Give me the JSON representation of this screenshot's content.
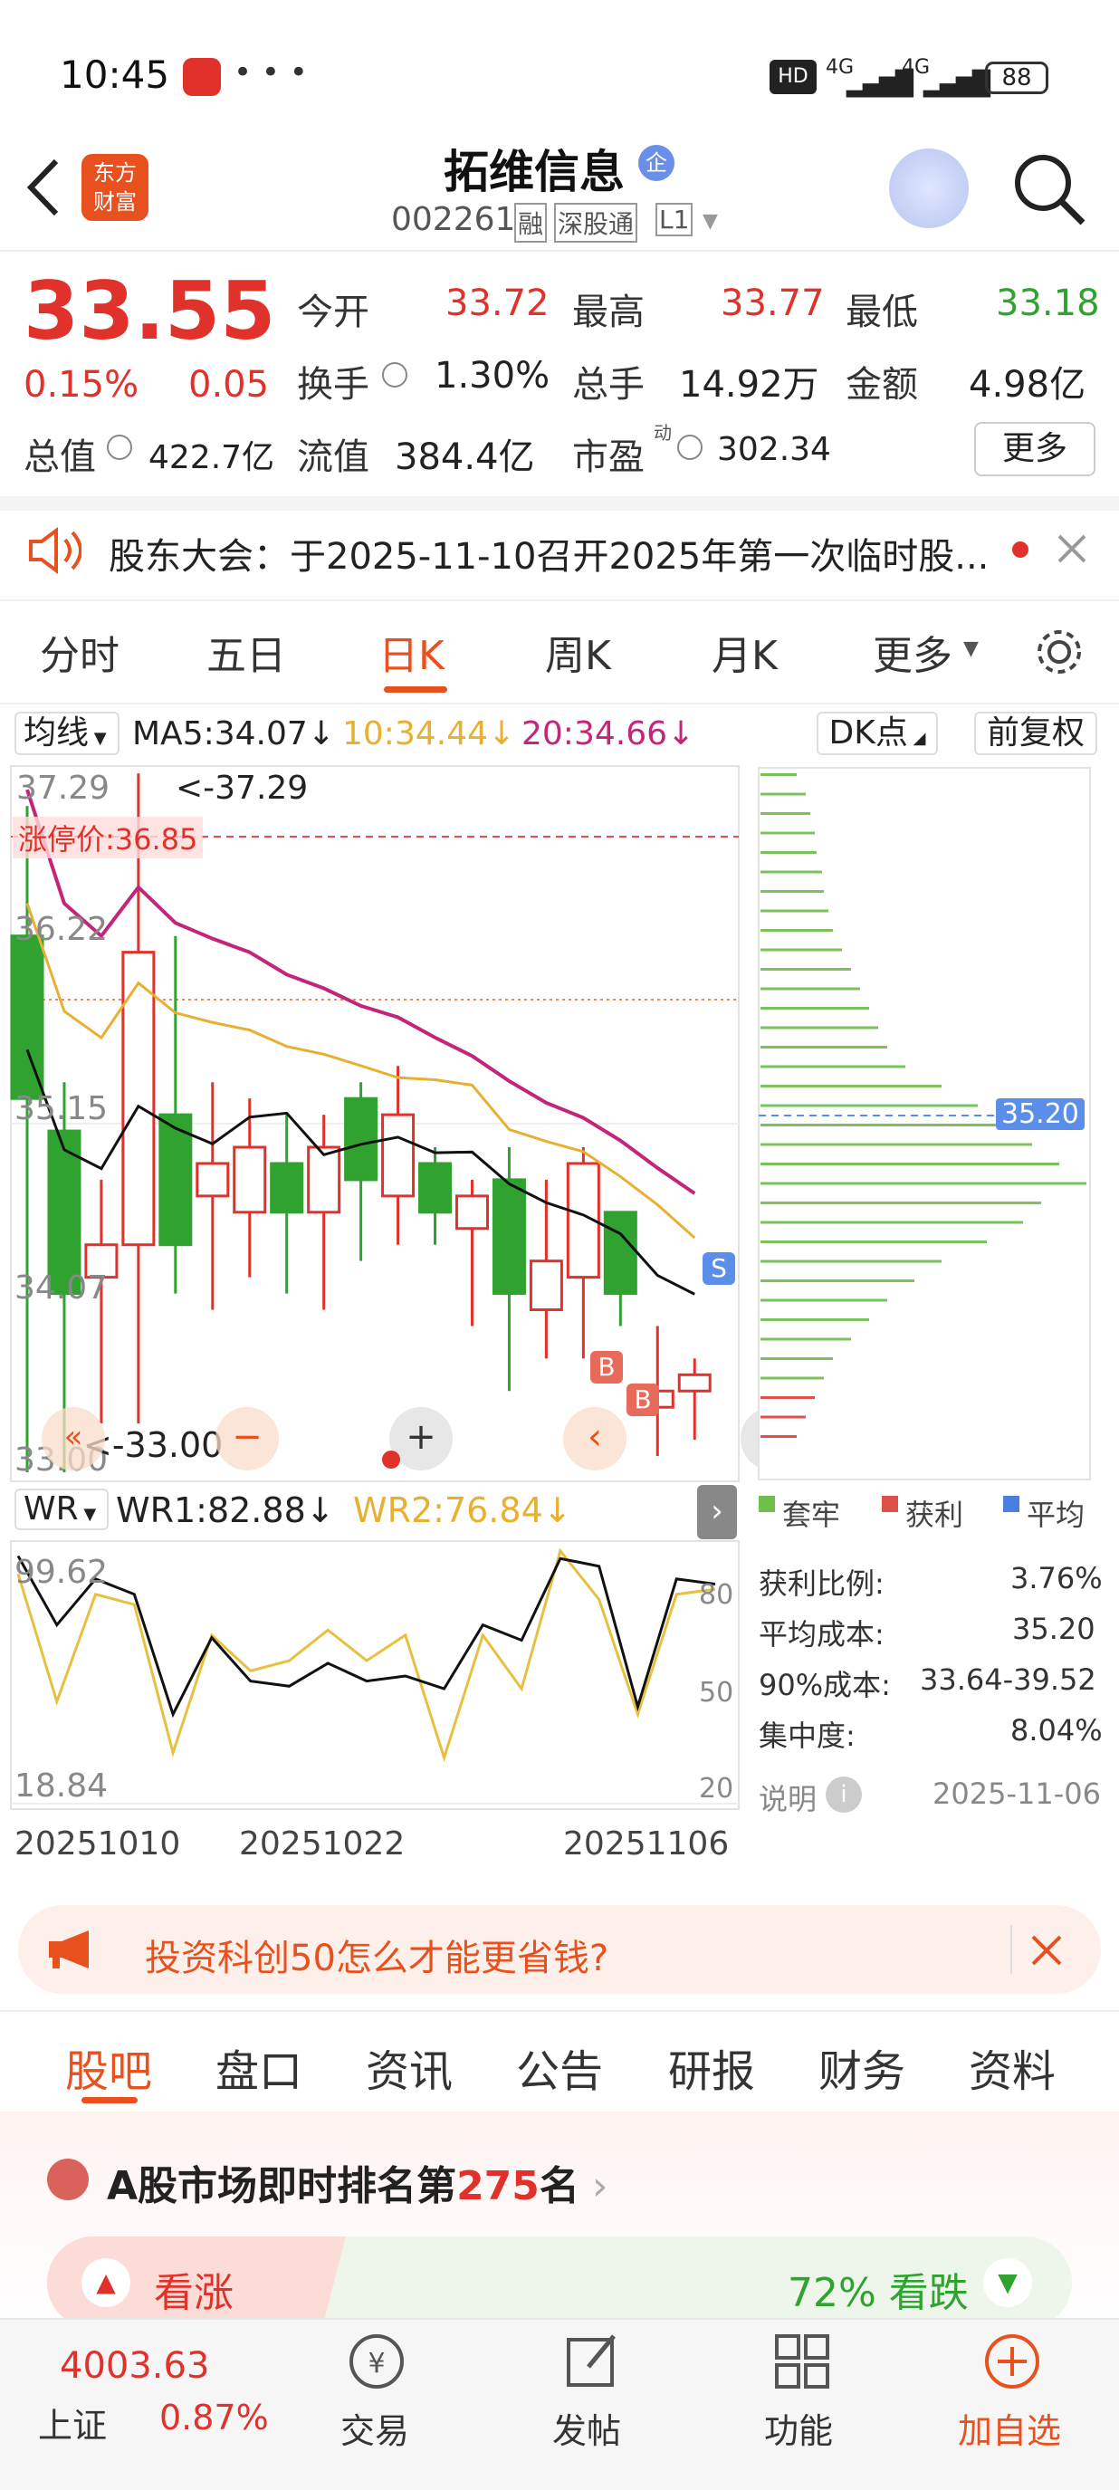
{
  "status": {
    "time": "10:45",
    "battery": "88",
    "net1": "4G",
    "net2": "4G",
    "hd": "HD"
  },
  "header": {
    "logo_line1": "东方",
    "logo_line2": "财富",
    "title": "拓维信息",
    "badge": "企",
    "code": "002261",
    "tags": [
      "融",
      "深股通",
      "L1"
    ]
  },
  "quote": {
    "price": "33.55",
    "pct": "0.15%",
    "chg": "0.05",
    "open_label": "今开",
    "open": "33.72",
    "high_label": "最高",
    "high": "33.77",
    "low_label": "最低",
    "low": "33.18",
    "turn_label": "换手",
    "turn": "1.30%",
    "vol_label": "总手",
    "vol": "14.92万",
    "amt_label": "金额",
    "amt": "4.98亿",
    "mcap_label": "总值",
    "mcap": "422.7亿",
    "fcap_label": "流值",
    "fcap": "384.4亿",
    "pe_label": "市盈",
    "pe_sup": "动",
    "pe": "302.34",
    "more": "更多"
  },
  "notice": {
    "text": "股东大会：于2025-11-10召开2025年第一次临时股..."
  },
  "tabs": [
    "分时",
    "五日",
    "日K",
    "周K",
    "月K",
    "更多"
  ],
  "ma": {
    "selector": "均线",
    "ma5": "MA5:34.07",
    "ma10": "10:34.44",
    "ma20": "20:34.66",
    "dk": "DK点",
    "fq": "前复权"
  },
  "main_chart": {
    "y_top": "37.29",
    "top_note": "<-37.29",
    "limit": "涨停价:36.85",
    "y2": "36.22",
    "y3": "35.15",
    "y4": "34.07",
    "y_bottom": "33.00",
    "bottom_note": "<-33.00",
    "cost_tag": "35.20"
  },
  "wr": {
    "selector": "WR",
    "wr1": "WR1:82.88",
    "wr2": "WR2:76.84",
    "y_top": "99.62",
    "y_bottom": "18.84",
    "r80": "80",
    "r50": "50",
    "r20": "20",
    "dates": [
      "20251010",
      "20251022",
      "20251106"
    ]
  },
  "chips": {
    "legend": [
      "套牢",
      "获利",
      "平均"
    ],
    "rows": [
      [
        "获利比例:",
        "3.76%"
      ],
      [
        "平均成本:",
        "35.20"
      ],
      [
        "90%成本:",
        "33.64-39.52"
      ],
      [
        "集中度:",
        "8.04%"
      ]
    ],
    "note": "说明",
    "date": "2025-11-06"
  },
  "ad": {
    "text": "投资科创50怎么才能更省钱?"
  },
  "nav": [
    "股吧",
    "盘口",
    "资讯",
    "公告",
    "研报",
    "财务",
    "资料"
  ],
  "rank": {
    "pre": "A股市场即时排名第",
    "num": "275",
    "post": "名"
  },
  "vote": {
    "up": "看涨",
    "down": "72% 看跌"
  },
  "bottom": {
    "index": "4003.63",
    "index_name": "上证",
    "index_pct": "0.87%",
    "items": [
      "交易",
      "发帖",
      "功能",
      "加自选"
    ]
  },
  "colors": {
    "up": "#e0322b",
    "down": "#2fa22f",
    "ma5": "#222222",
    "ma10": "#e8b030",
    "ma20": "#c2257a",
    "accent": "#e8501e"
  },
  "chart_data": {
    "type": "candlestick",
    "x_labels": [
      "20251010",
      "20251022",
      "20251106"
    ],
    "ylim": [
      33.0,
      37.29
    ],
    "candles": [
      [
        36.3,
        35.3,
        37.1,
        33.0
      ],
      [
        35.1,
        34.1,
        35.4,
        33.0
      ],
      [
        34.2,
        34.4,
        34.8,
        33.3
      ],
      [
        34.4,
        36.2,
        37.3,
        33.3
      ],
      [
        35.2,
        34.4,
        36.3,
        34.1
      ],
      [
        34.7,
        34.9,
        35.4,
        34.0
      ],
      [
        34.6,
        35.0,
        35.3,
        34.2
      ],
      [
        34.9,
        34.6,
        35.2,
        34.1
      ],
      [
        34.6,
        35.0,
        35.2,
        34.0
      ],
      [
        35.3,
        34.8,
        35.4,
        34.3
      ],
      [
        34.7,
        35.2,
        35.5,
        34.4
      ],
      [
        34.9,
        34.6,
        35.0,
        34.4
      ],
      [
        34.5,
        34.7,
        34.8,
        33.9
      ],
      [
        34.8,
        34.1,
        35.0,
        33.5
      ],
      [
        34.0,
        34.3,
        34.8,
        33.7
      ],
      [
        34.2,
        34.9,
        35.0,
        33.7
      ],
      [
        34.6,
        34.1,
        34.6,
        33.9
      ],
      [
        33.4,
        33.5,
        33.9,
        33.1
      ],
      [
        33.5,
        33.6,
        33.7,
        33.2
      ]
    ]
  },
  "wr_data": {
    "wr1": [
      97,
      70,
      88,
      82,
      35,
      65,
      48,
      46,
      55,
      48,
      50,
      45,
      70,
      64,
      96,
      93,
      38,
      88,
      86
    ],
    "wr2": [
      90,
      40,
      82,
      78,
      20,
      66,
      52,
      56,
      68,
      56,
      66,
      18,
      66,
      45,
      99,
      80,
      35,
      82,
      84
    ]
  }
}
